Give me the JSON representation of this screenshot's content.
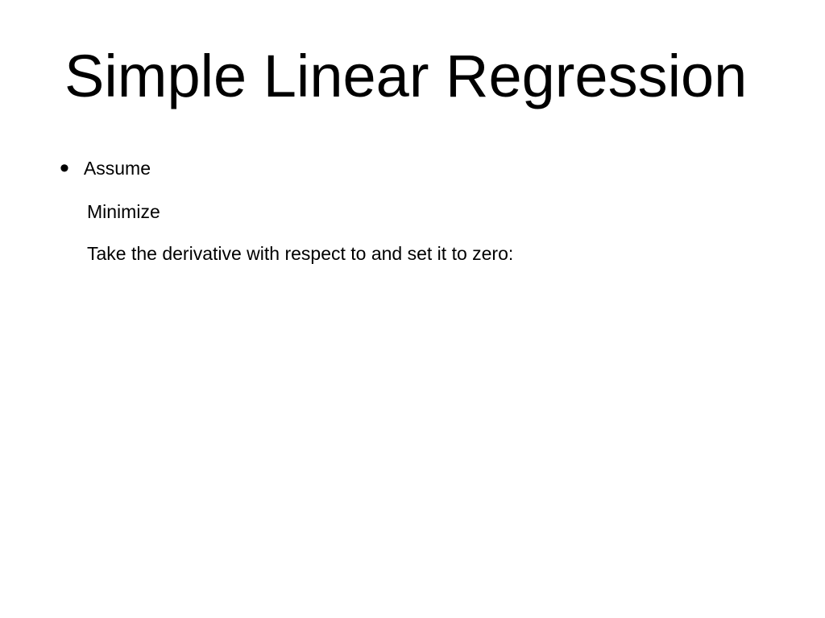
{
  "slide": {
    "title": "Simple Linear Regression",
    "bullet_marker": "•",
    "line1": "Assume",
    "line2": "Minimize",
    "line3": "Take the derivative with respect to  and set it to zero:"
  }
}
